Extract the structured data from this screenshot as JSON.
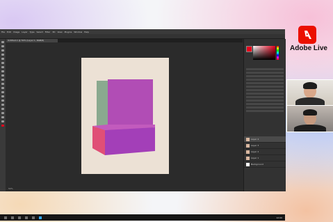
{
  "stream": {
    "brand": "Adobe Live"
  },
  "photoshop": {
    "tab_title": "Untitled-1 @ 50% (Layer 1, RGB/8)",
    "status_text": "50%",
    "menu": [
      "File",
      "Edit",
      "Image",
      "Layer",
      "Type",
      "Select",
      "Filter",
      "3D",
      "View",
      "Plugins",
      "Window",
      "Help"
    ],
    "layers": [
      {
        "name": "Layer 4"
      },
      {
        "name": "Layer 3"
      },
      {
        "name": "Layer 2"
      },
      {
        "name": "Layer 1"
      },
      {
        "name": "Background"
      }
    ]
  },
  "taskbar": {
    "time": "12:00"
  },
  "colors": {
    "canvas_bg": "#ece1d5",
    "box_top": "#b14db5",
    "box_side": "#8aa98f",
    "base_front": "#a33fb8",
    "base_side": "#e04f76",
    "accent_red": "#eb1000"
  }
}
